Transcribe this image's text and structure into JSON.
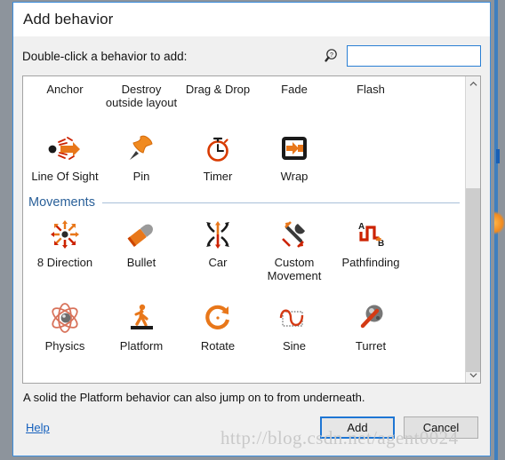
{
  "window": {
    "title": "Add behavior"
  },
  "prompt": {
    "label": "Double-click a behavior to add:",
    "search_icon": "search-help-icon",
    "search_value": "",
    "search_placeholder": ""
  },
  "list": {
    "partial_row": [
      {
        "label": "Anchor",
        "icon": "anchor-icon"
      },
      {
        "label": "Destroy outside layout",
        "icon": "destroy-outside-layout-icon"
      },
      {
        "label": "Drag & Drop",
        "icon": "drag-and-drop-icon"
      },
      {
        "label": "Fade",
        "icon": "fade-icon"
      },
      {
        "label": "Flash",
        "icon": "flash-icon"
      }
    ],
    "rows": [
      [
        {
          "label": "Line Of Sight",
          "icon": "line-of-sight-icon"
        },
        {
          "label": "Pin",
          "icon": "pin-icon"
        },
        {
          "label": "Timer",
          "icon": "timer-icon"
        },
        {
          "label": "Wrap",
          "icon": "wrap-icon"
        }
      ]
    ],
    "section": {
      "title": "Movements",
      "rows": [
        [
          {
            "label": "8 Direction",
            "icon": "eight-direction-icon"
          },
          {
            "label": "Bullet",
            "icon": "bullet-icon"
          },
          {
            "label": "Car",
            "icon": "car-icon"
          },
          {
            "label": "Custom Movement",
            "icon": "custom-movement-icon"
          },
          {
            "label": "Pathfinding",
            "icon": "pathfinding-icon"
          }
        ],
        [
          {
            "label": "Physics",
            "icon": "physics-icon"
          },
          {
            "label": "Platform",
            "icon": "platform-icon"
          },
          {
            "label": "Rotate",
            "icon": "rotate-icon"
          },
          {
            "label": "Sine",
            "icon": "sine-icon"
          },
          {
            "label": "Turret",
            "icon": "turret-icon"
          }
        ]
      ]
    },
    "scrollbar": {
      "up_icon": "chevron-up-icon",
      "down_icon": "chevron-down-icon"
    }
  },
  "hint": "A solid the Platform behavior can also jump on to from underneath.",
  "footer": {
    "help_label": "Help",
    "add_label": "Add",
    "cancel_label": "Cancel"
  },
  "watermark": "http://blog.csdn.net/agent0024",
  "colors": {
    "accent_blue": "#2a7fd4",
    "window_border": "#3c8ddc",
    "section_heading": "#2a6099",
    "icon_orange": "#e8771a",
    "icon_red": "#cc2200",
    "link_blue": "#1560bd"
  }
}
